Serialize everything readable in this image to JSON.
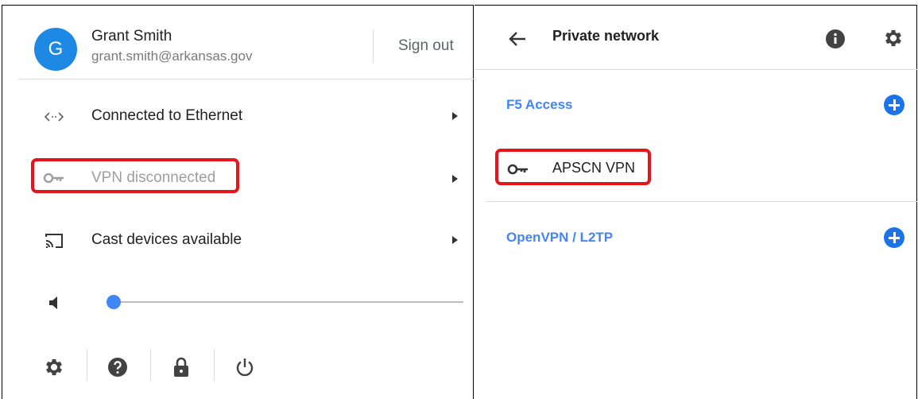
{
  "user": {
    "avatar_letter": "G",
    "name": "Grant Smith",
    "email": "grant.smith@arkansas.gov",
    "sign_out_label": "Sign out"
  },
  "status_rows": [
    {
      "icon": "ethernet-icon",
      "label": "Connected to Ethernet"
    },
    {
      "icon": "vpn-key-icon",
      "label": "VPN disconnected"
    },
    {
      "icon": "cast-icon",
      "label": "Cast devices available"
    }
  ],
  "volume": {
    "icon": "speaker-icon",
    "level": 0.0
  },
  "bottom_bar": [
    "settings-gear-icon",
    "help-icon",
    "lock-icon",
    "power-icon"
  ],
  "private_network": {
    "title": "Private network",
    "sections": [
      {
        "label": "F5 Access",
        "items": []
      },
      {
        "label": "",
        "items": [
          {
            "icon": "vpn-key-icon",
            "label": "APSCN VPN"
          }
        ]
      },
      {
        "label": "OpenVPN / L2TP",
        "items": []
      }
    ]
  },
  "colors": {
    "accent": "#4285f4",
    "avatar": "#1e88e5",
    "highlight": "#e8141b",
    "disabled_text": "#9e9e9e"
  }
}
